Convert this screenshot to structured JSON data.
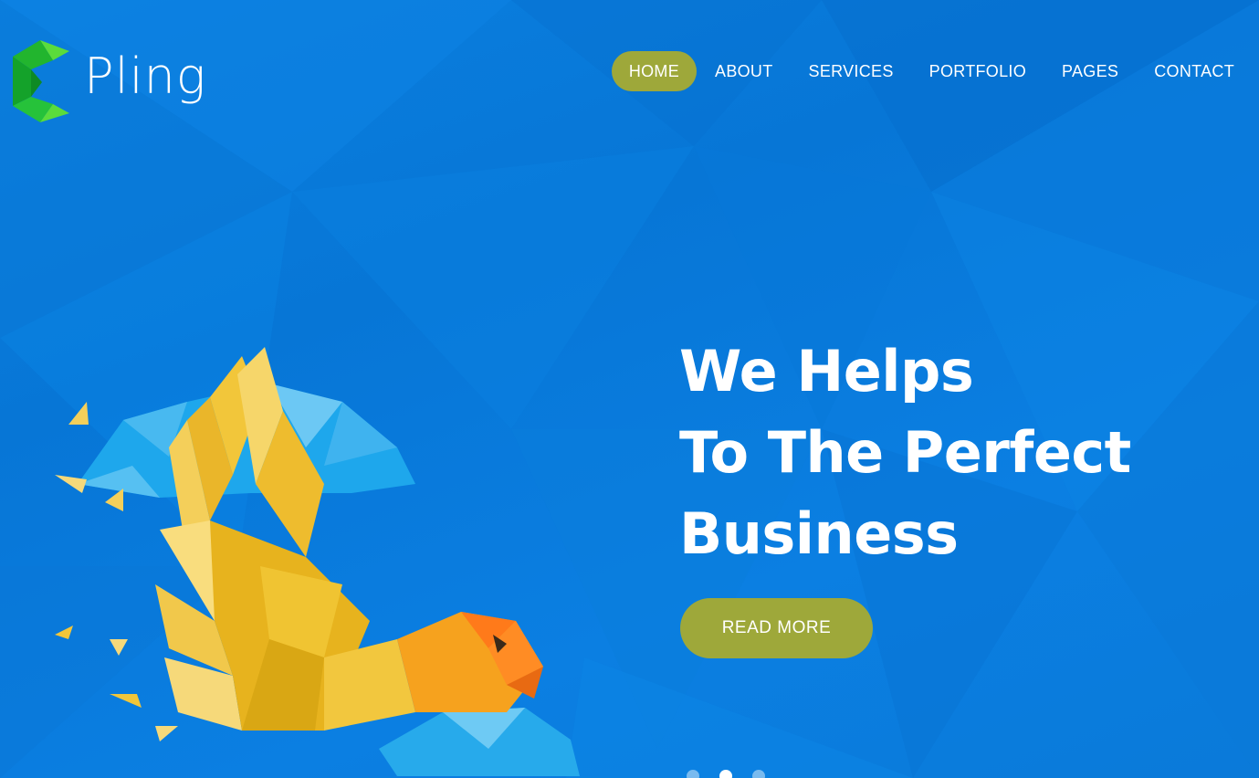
{
  "header": {
    "logo_text": "Pling",
    "logo_icon": "pling-logo-icon",
    "nav": [
      {
        "label": "HOME",
        "active": true
      },
      {
        "label": "ABOUT",
        "active": false
      },
      {
        "label": "SERVICES",
        "active": false
      },
      {
        "label": "PORTFOLIO",
        "active": false
      },
      {
        "label": "PAGES",
        "active": false
      },
      {
        "label": "CONTACT",
        "active": false
      }
    ]
  },
  "hero": {
    "headline_lines": [
      "We Helps",
      "To The Perfect",
      "Business"
    ],
    "cta_label": "READ MORE",
    "illustration": "low-poly-parrot-illustration",
    "slider": {
      "count": 3,
      "active_index": 1
    }
  },
  "colors": {
    "background": "#0a7bdc",
    "accent": "#9ea83a",
    "logo_green": "#22c23a",
    "text": "#ffffff"
  }
}
